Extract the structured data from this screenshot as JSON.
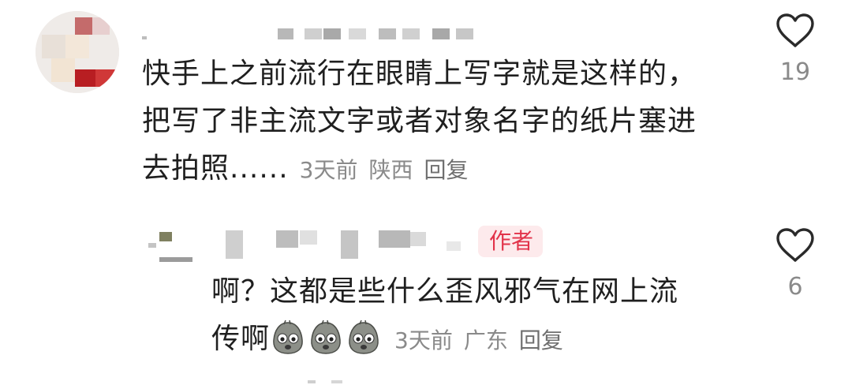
{
  "main_comment": {
    "text_line1": "快手上之前流行在眼睛上写字就是这样的，",
    "text_line2": "把写了非主流文字或者对象名字的纸片塞进",
    "text_line3": "去拍照......",
    "time": "3天前",
    "location": "陕西",
    "reply_label": "回复",
    "like_count": "19",
    "like_icon": "heart-outline-icon"
  },
  "reply_comment": {
    "author_badge": "作者",
    "text_line1": "啊？这都是些什么歪风邪气在网上流",
    "text_line2": "传啊",
    "emoji_icon": "sad-potato-emoji-icon",
    "time": "3天前",
    "location": "广东",
    "reply_label": "回复",
    "like_count": "6",
    "like_icon": "heart-outline-icon"
  },
  "colors": {
    "text": "#1f1f1f",
    "meta": "#8a8a8a",
    "badge_bg": "#fdeaec",
    "badge_text": "#e2334a"
  }
}
